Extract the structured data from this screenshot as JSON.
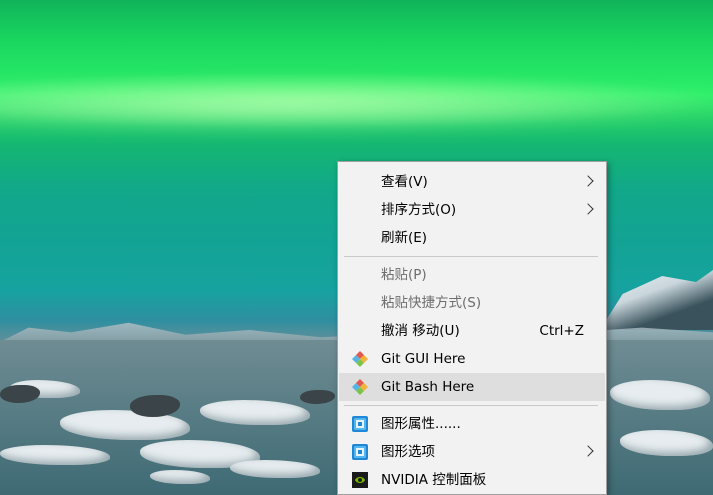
{
  "menu": {
    "items": [
      {
        "label": "查看(V)",
        "has_submenu": true
      },
      {
        "label": "排序方式(O)",
        "has_submenu": true
      },
      {
        "label": "刷新(E)"
      },
      {
        "label": "粘贴(P)",
        "disabled": true
      },
      {
        "label": "粘贴快捷方式(S)",
        "disabled": true
      },
      {
        "label": "撤消 移动(U)",
        "shortcut": "Ctrl+Z"
      },
      {
        "label": "Git GUI Here",
        "icon": "git-icon"
      },
      {
        "label": "Git Bash Here",
        "icon": "git-icon",
        "highlighted": true
      },
      {
        "label": "图形属性......",
        "icon": "intel-graphics-icon"
      },
      {
        "label": "图形选项",
        "icon": "intel-graphics-icon",
        "has_submenu": true
      },
      {
        "label": "NVIDIA 控制面板",
        "icon": "nvidia-icon"
      }
    ],
    "colors": {
      "background": "#f2f2f2",
      "highlight": "#dedede",
      "disabled_text": "#6d6d6d"
    }
  }
}
